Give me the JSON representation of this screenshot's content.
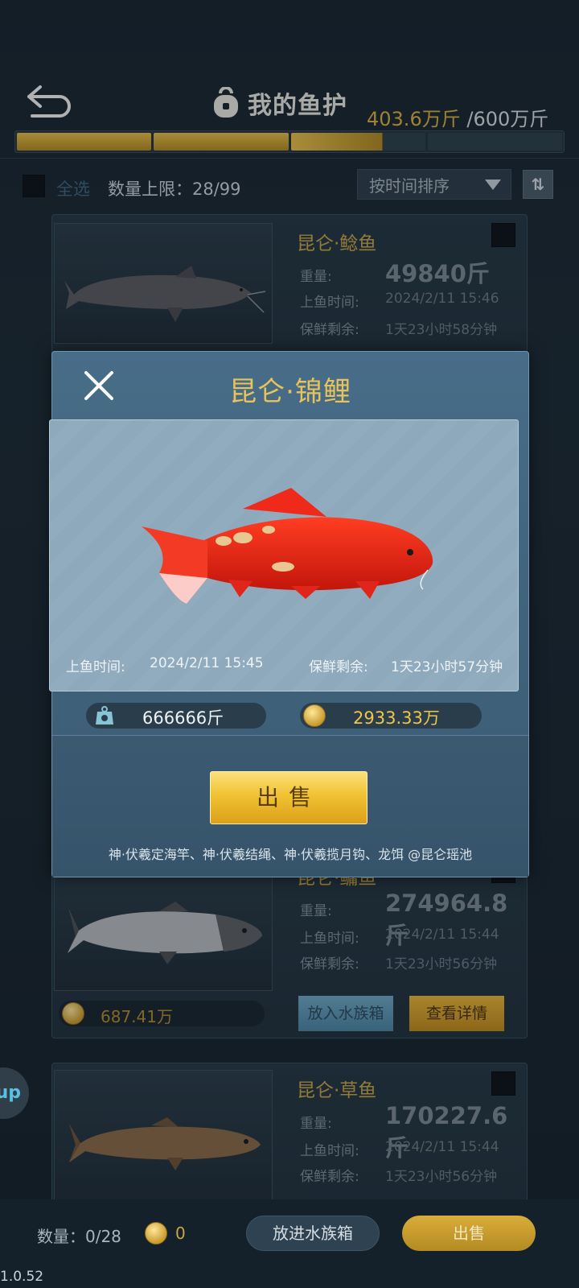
{
  "header": {
    "title": "我的鱼护",
    "capacity_current": "403.6万斤",
    "capacity_max": "/600万斤",
    "capacity_fill": 0.673
  },
  "controls": {
    "select_all": "全选",
    "limit": "数量上限：28/99",
    "sort": "按时间排序",
    "sort_toggle": "⇅"
  },
  "cards": [
    {
      "name": "昆仑·鲶鱼",
      "weight_label": "重量:",
      "weight": "49840斤",
      "catch_label": "上鱼时间:",
      "catch_time": "2024/2/11  15:46",
      "fresh_label": "保鲜剩余:",
      "fresh": "1天23小时58分钟"
    },
    {
      "name": "昆仑·鳙鱼",
      "weight_label": "重量:",
      "weight": "274964.8斤",
      "catch_label": "上鱼时间:",
      "catch_time": "2024/2/11  15:44",
      "fresh_label": "保鲜剩余:",
      "fresh": "1天23小时56分钟",
      "value": "687.41万",
      "btn_tank": "放入水族箱",
      "btn_detail": "查看详情"
    },
    {
      "name": "昆仑·草鱼",
      "weight_label": "重量:",
      "weight": "170227.6斤",
      "catch_label": "上鱼时间:",
      "catch_time": "2024/2/11  15:44",
      "fresh_label": "保鲜剩余:",
      "fresh": "1天23小时56分钟"
    }
  ],
  "modal": {
    "title": "昆仑·锦鲤",
    "catch_label": "上鱼时间:",
    "catch_time": "2024/2/11  15:45",
    "fresh_label": "保鲜剩余:",
    "fresh": "1天23小时57分钟",
    "weight": "666666斤",
    "value": "2933.33万",
    "sell": "出售",
    "source": "神·伏羲定海竿、神·伏羲结绳、神·伏羲揽月钩、龙饵  @昆仑瑶池"
  },
  "side_bubble": "up",
  "bottom": {
    "count": "数量：0/28",
    "coin_value": "0",
    "put_tank": "放进水族箱",
    "sell": "出售"
  },
  "version": "1.0.52",
  "colors": {
    "gold": "#d9b13f",
    "koi_red": "#e8251a",
    "modal_bg": "#486d88"
  }
}
